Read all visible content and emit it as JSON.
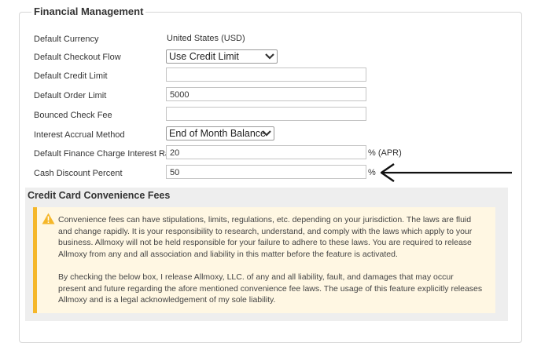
{
  "section_title": "Financial Management",
  "fields": {
    "default_currency": {
      "label": "Default Currency",
      "value": "United States (USD)"
    },
    "default_checkout_flow": {
      "label": "Default Checkout Flow",
      "selected": "Use Credit Limit"
    },
    "default_credit_limit": {
      "label": "Default Credit Limit",
      "value": ""
    },
    "default_order_limit": {
      "label": "Default Order Limit",
      "value": "5000"
    },
    "bounced_check_fee": {
      "label": "Bounced Check Fee",
      "value": ""
    },
    "interest_accrual_method": {
      "label": "Interest Accrual Method",
      "selected": "End of Month Balance"
    },
    "finance_charge_rate": {
      "label": "Default Finance Charge Interest Rate",
      "value": "20",
      "suffix": "% (APR)"
    },
    "cash_discount_percent": {
      "label": "Cash Discount Percent",
      "value": "50",
      "suffix": "%"
    }
  },
  "convenience": {
    "title": "Credit Card Convenience Fees",
    "paragraph1": "Convenience fees can have stipulations, limits, regulations, etc. depending on your jurisdiction. The laws are fluid and change rapidly. It is your responsibility to research, understand, and comply with the laws which apply to your business. Allmoxy will not be held responsible for your failure to adhere to these laws. You are required to release Allmoxy from any and all association and liability in this matter before the feature is activated.",
    "paragraph2": "By checking the below box, I release Allmoxy, LLC. of any and all liability, fault, and damages that may occur present and future regarding the afore mentioned convenience fee laws. The usage of this feature explicitly releases Allmoxy and is a legal acknowledgement of my sole liability."
  },
  "colors": {
    "warning_border": "#f5b72a",
    "warning_bg": "#fff7e3",
    "section_bg": "#eeeeee"
  },
  "icons": {
    "warning": "warning-triangle-icon",
    "select": "chevron-down-icon",
    "annotation": "arrow-left-icon"
  }
}
